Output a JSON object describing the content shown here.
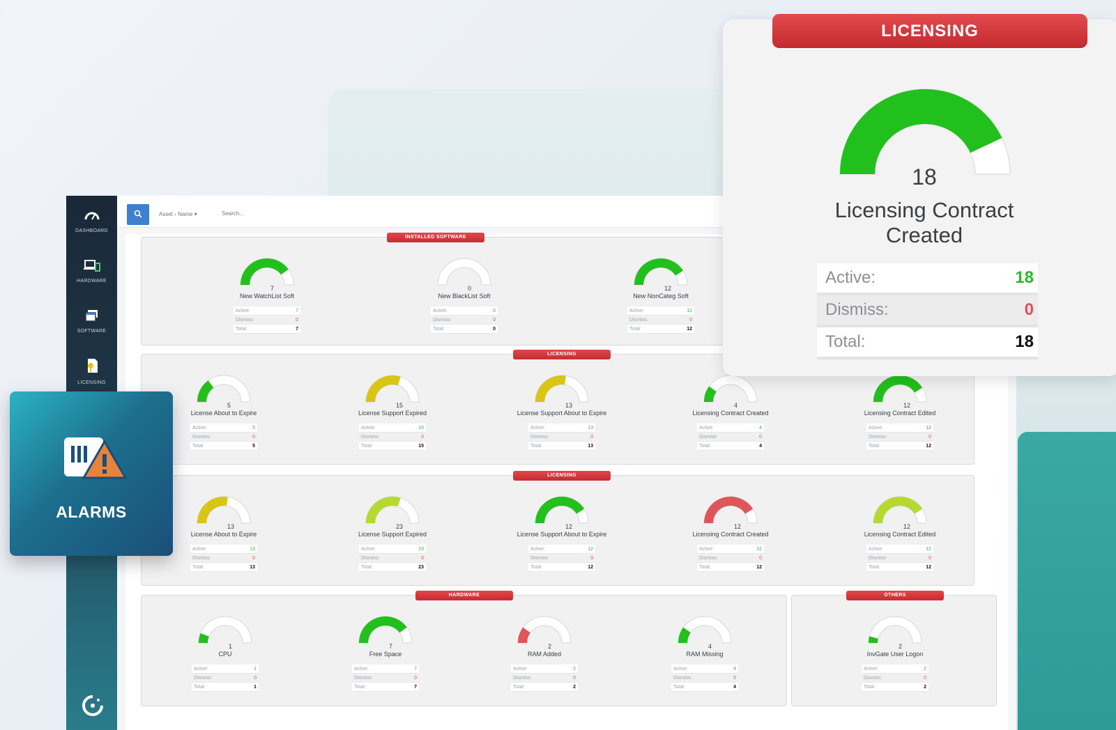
{
  "sidebar": {
    "items": [
      {
        "label": "DASHBOARD",
        "icon": "gauge-icon"
      },
      {
        "label": "HARDWARE",
        "icon": "devices-icon"
      },
      {
        "label": "SOFTWARE",
        "icon": "software-icon"
      },
      {
        "label": "LICENSING",
        "icon": "license-icon"
      }
    ],
    "logo_icon": "invgate-logo-icon"
  },
  "topbar": {
    "breadcrumb": "Asset  ›  Name  ▾",
    "search_placeholder": "Search..."
  },
  "stat_labels": {
    "active": "Active:",
    "dismiss": "Dismiss:",
    "total": "Total:"
  },
  "colors": {
    "green": "#22c01c",
    "yellow": "#d9c514",
    "lime": "#b6d932",
    "red": "#e05558",
    "track": "#ffffff"
  },
  "sections": [
    {
      "title": "INSTALLED SOFTWARE",
      "widgets": [
        {
          "label": "New WatchList Soft",
          "value": 7,
          "active": 7,
          "dismiss": 0,
          "total": 7,
          "fraction": 0.8,
          "color": "#22c01c"
        },
        {
          "label": "New BlackList Soft",
          "value": 0,
          "active": 0,
          "dismiss": 0,
          "total": 0,
          "fraction": 0.0,
          "color": "#22c01c"
        },
        {
          "label": "New NonCateg Soft",
          "value": 12,
          "active": 12,
          "dismiss": 0,
          "total": 12,
          "fraction": 0.82,
          "color": "#22c01c"
        }
      ]
    },
    {
      "title": "LICENSING",
      "widgets": [
        {
          "label": "License About to Expire",
          "value": 5,
          "active": 5,
          "dismiss": 0,
          "total": 5,
          "fraction": 0.3,
          "color": "#22c01c"
        },
        {
          "label": "License Support Expired",
          "value": 15,
          "active": 15,
          "dismiss": 0,
          "total": 15,
          "fraction": 0.6,
          "color": "#d9c514"
        },
        {
          "label": "License Support About to Expire",
          "value": 13,
          "active": 13,
          "dismiss": 0,
          "total": 13,
          "fraction": 0.55,
          "color": "#d9c514"
        },
        {
          "label": "Licensing Contract Created",
          "value": 4,
          "active": 4,
          "dismiss": 0,
          "total": 4,
          "fraction": 0.2,
          "color": "#22c01c"
        },
        {
          "label": "Licensing Contract Edited",
          "value": 12,
          "active": 12,
          "dismiss": 0,
          "total": 12,
          "fraction": 0.82,
          "color": "#22c01c"
        }
      ]
    },
    {
      "title": "LICENSING",
      "widgets": [
        {
          "label": "License About to Expire",
          "value": 13,
          "active": 13,
          "dismiss": 0,
          "total": 13,
          "fraction": 0.55,
          "color": "#d9c514"
        },
        {
          "label": "License Support Expired",
          "value": 23,
          "active": 23,
          "dismiss": 0,
          "total": 23,
          "fraction": 0.6,
          "color": "#b6d932"
        },
        {
          "label": "License Support About to Expire",
          "value": 12,
          "active": 12,
          "dismiss": 0,
          "total": 12,
          "fraction": 0.82,
          "color": "#22c01c"
        },
        {
          "label": "Licensing Contract Created",
          "value": 12,
          "active": 12,
          "dismiss": 0,
          "total": 12,
          "fraction": 0.82,
          "color": "#e05558"
        },
        {
          "label": "Licensing Contract Edited",
          "value": 12,
          "active": 12,
          "dismiss": 0,
          "total": 12,
          "fraction": 0.82,
          "color": "#b6d932"
        }
      ]
    },
    {
      "title": "HARDWARE",
      "widgets": [
        {
          "label": "CPU",
          "value": 1,
          "active": 1,
          "dismiss": 0,
          "total": 1,
          "fraction": 0.12,
          "color": "#22c01c"
        },
        {
          "label": "Free Space",
          "value": 7,
          "active": 7,
          "dismiss": 0,
          "total": 7,
          "fraction": 0.8,
          "color": "#22c01c"
        },
        {
          "label": "RAM Added",
          "value": 2,
          "active": 2,
          "dismiss": 0,
          "total": 2,
          "fraction": 0.2,
          "color": "#e05558"
        },
        {
          "label": "RAM Missing",
          "value": 4,
          "active": 4,
          "dismiss": 0,
          "total": 4,
          "fraction": 0.2,
          "color": "#22c01c"
        }
      ]
    },
    {
      "title": "OTHERS",
      "widgets": [
        {
          "label": "InvGate User Logon",
          "value": 2,
          "active": 2,
          "dismiss": 0,
          "total": 2,
          "fraction": 0.08,
          "color": "#22c01c"
        }
      ]
    }
  ],
  "alarms": {
    "title": "ALARMS",
    "icon": "alarm-warning-icon"
  },
  "popup": {
    "title": "LICENSING",
    "value": "18",
    "label_line1": "Licensing Contract",
    "label_line2": "Created",
    "fraction": 0.86,
    "color": "#22c01c",
    "active": "18",
    "dismiss": "0",
    "total": "18"
  }
}
